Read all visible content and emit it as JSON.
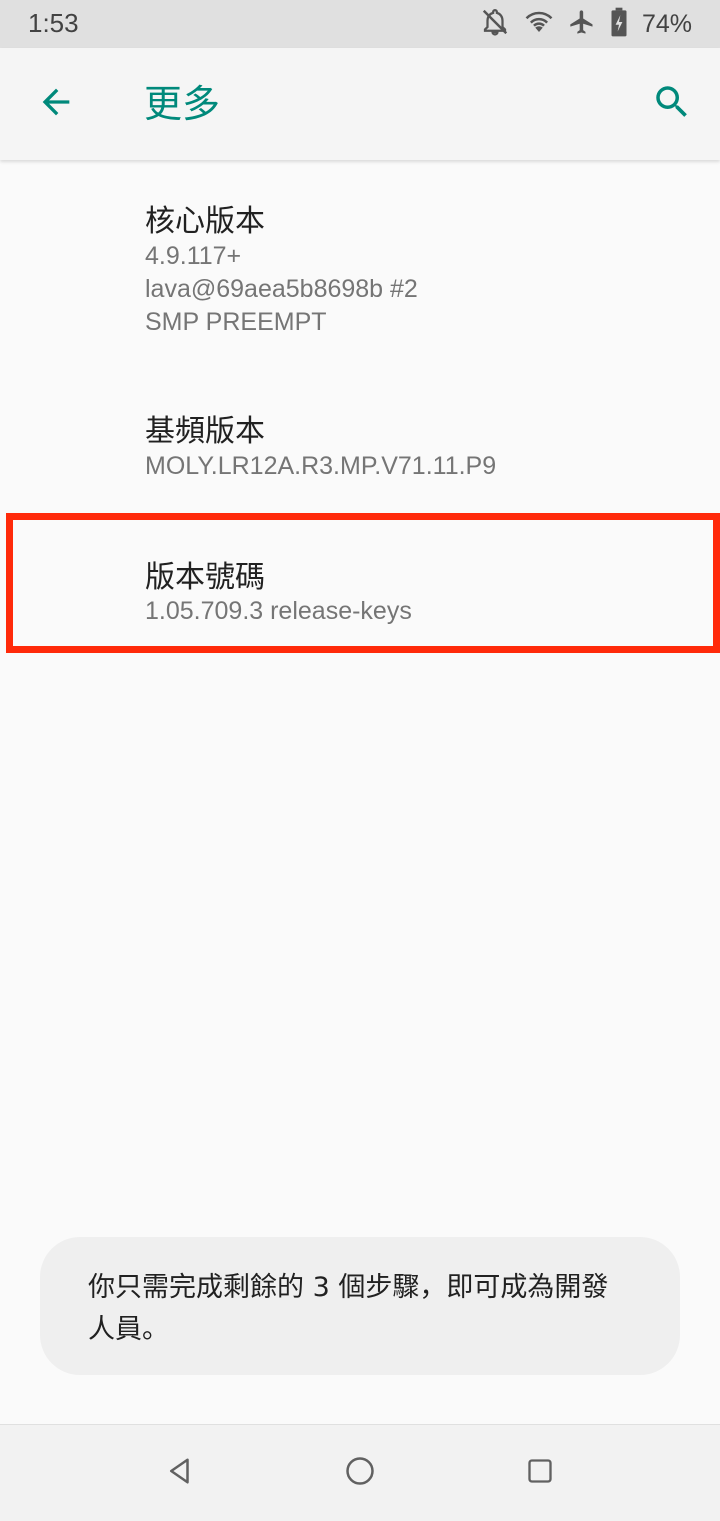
{
  "status_bar": {
    "time": "1:53",
    "battery_percent": "74%",
    "icons": [
      "notifications-off-icon",
      "wifi-icon",
      "airplane-mode-icon",
      "battery-charging-icon"
    ]
  },
  "app_bar": {
    "title": "更多",
    "back_icon": "arrow-back-icon",
    "search_icon": "search-icon",
    "accent_color": "#00897b"
  },
  "preferences": [
    {
      "title": "核心版本",
      "summary": "4.9.117+\nlava@69aea5b8698b #2\nSMP PREEMPT"
    },
    {
      "title": "基頻版本",
      "summary": "MOLY.LR12A.R3.MP.V71.11.P9"
    },
    {
      "title": "版本號碼",
      "summary": "1.05.709.3 release-keys"
    }
  ],
  "highlight_color": "#ff2a0a",
  "toast": {
    "message": "你只需完成剩餘的 3 個步驟，即可成為開發人員。"
  },
  "nav_bar": {
    "icons": [
      "nav-back-icon",
      "nav-home-icon",
      "nav-recents-icon"
    ]
  }
}
